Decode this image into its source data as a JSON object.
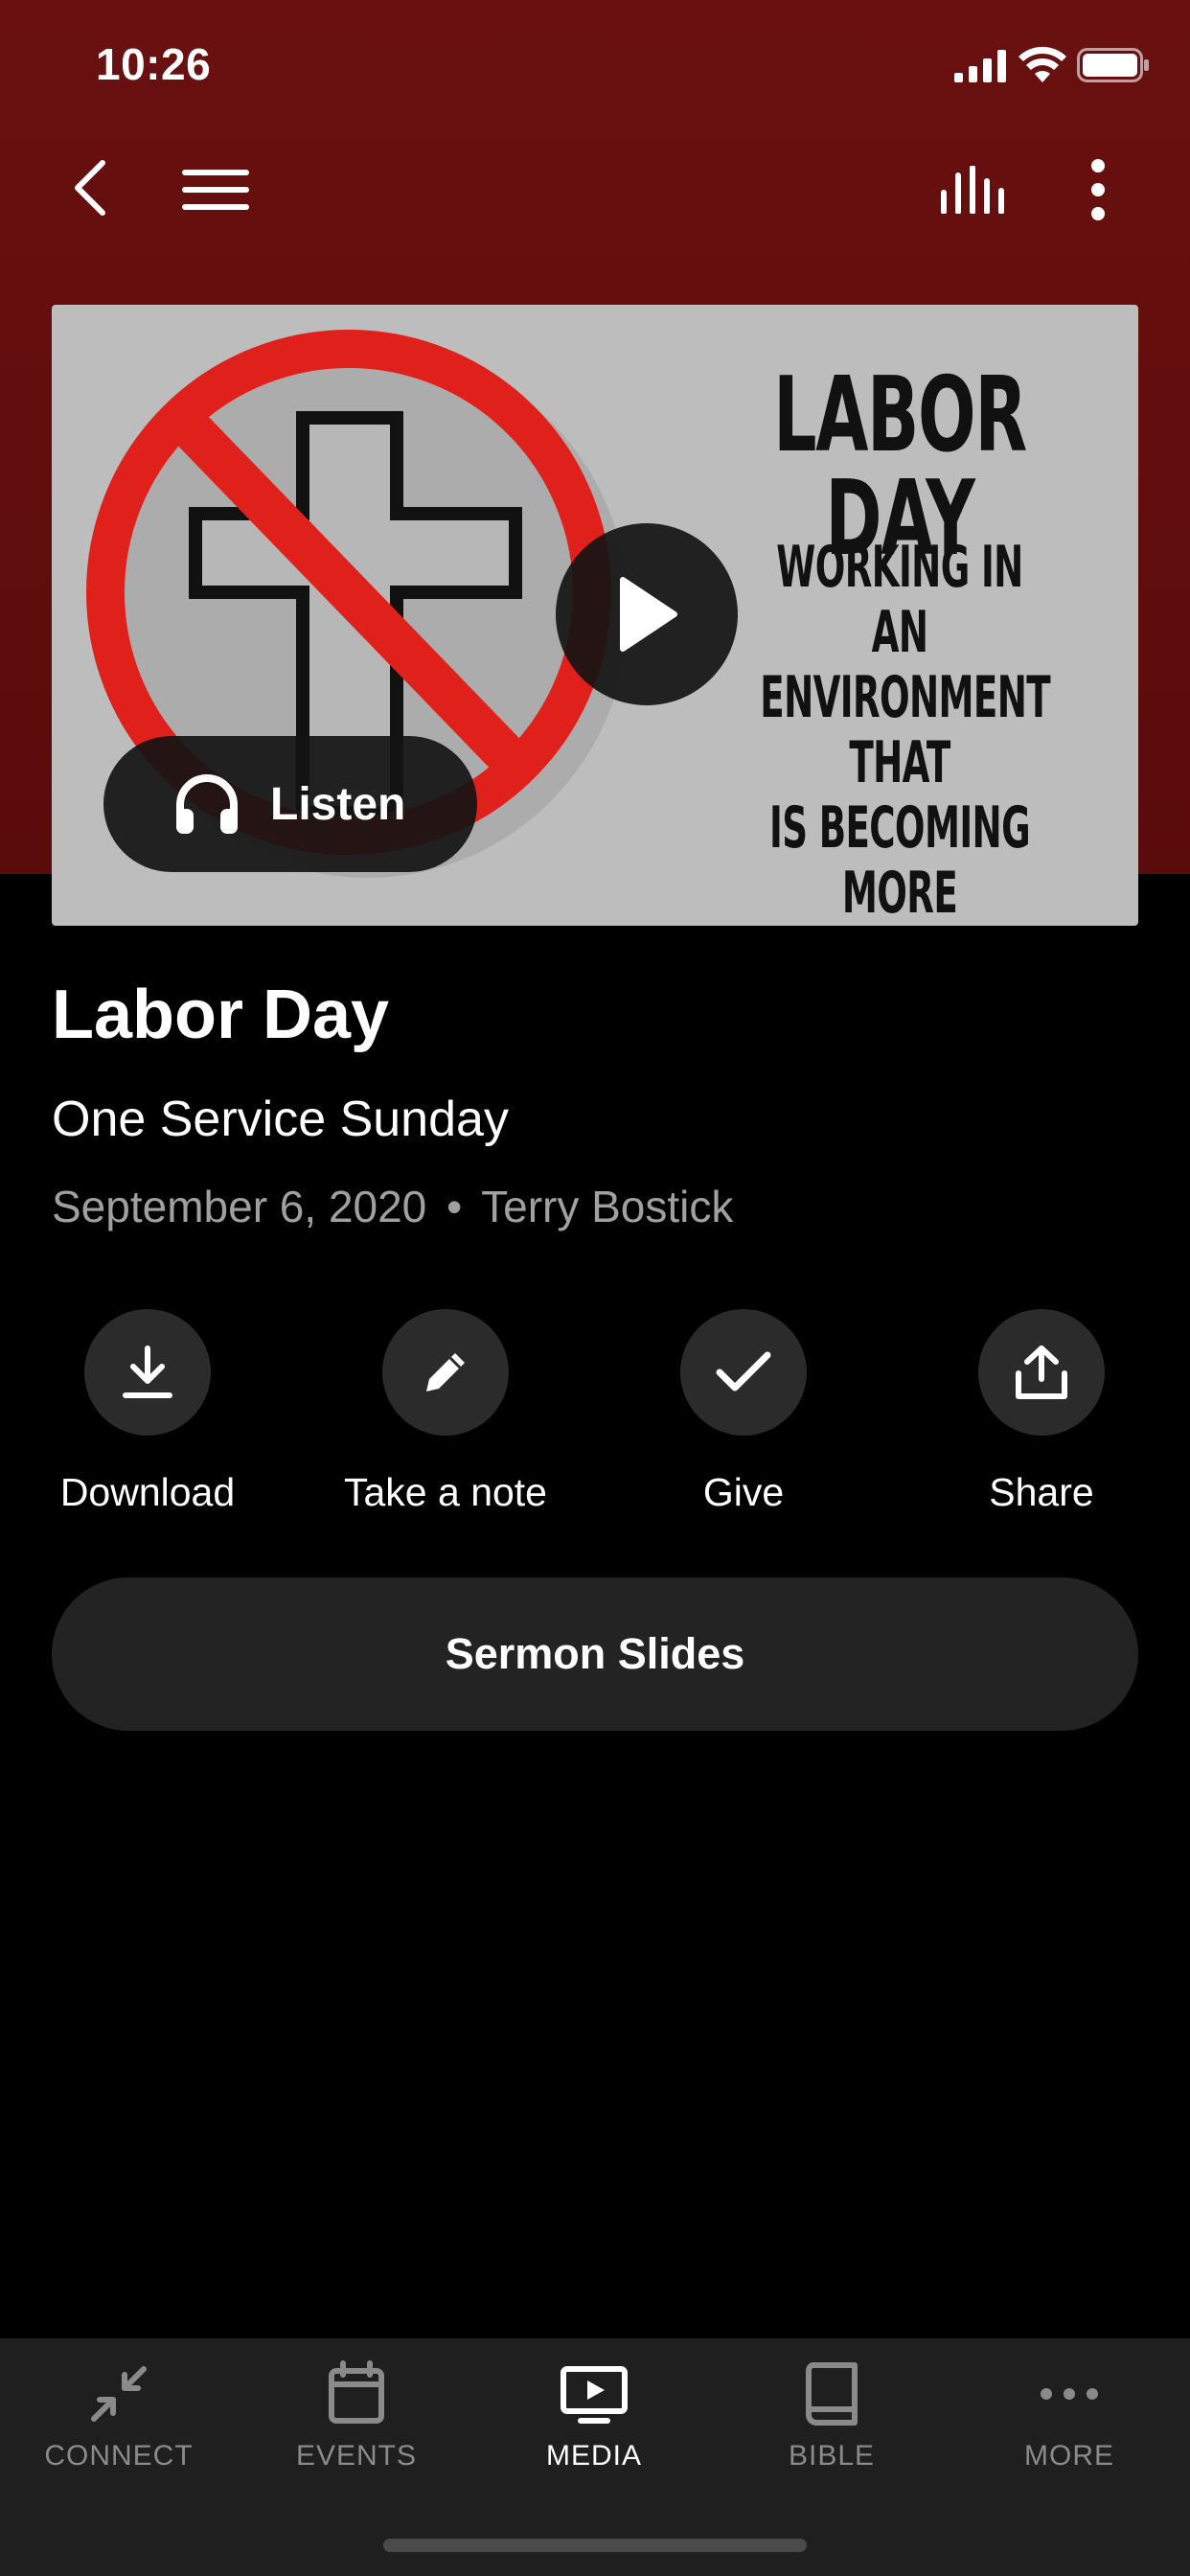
{
  "status_bar": {
    "time": "10:26"
  },
  "media": {
    "card_title": "LABOR DAY",
    "card_subtitle": "WORKING IN AN\nENVIRONMENT THAT\nIS BECOMING\nMORE HOSTILE\nTO CHRISTIANS",
    "listen_label": "Listen"
  },
  "sermon": {
    "title": "Labor Day",
    "series": "One Service Sunday",
    "date": "September 6, 2020",
    "separator": "•",
    "speaker": "Terry Bostick"
  },
  "actions": {
    "download": "Download",
    "note": "Take a note",
    "give": "Give",
    "share": "Share"
  },
  "slides_button": "Sermon Slides",
  "tabs": {
    "connect": "CONNECT",
    "events": "EVENTS",
    "media": "MEDIA",
    "bible": "BIBLE",
    "more": "MORE",
    "active": "MEDIA"
  },
  "colors": {
    "header_red": "#6a1010",
    "prohibition_red": "#e0201a",
    "card_background": "#bdbdbd",
    "inactive_tab": "#8a8a8a"
  }
}
